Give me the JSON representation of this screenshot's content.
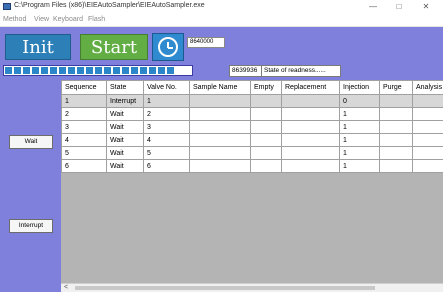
{
  "window": {
    "title": "C:\\Program Files (x86)\\EIEAutoSampler\\EIEAutoSampler.exe",
    "minimize": "—",
    "maximize": "□",
    "close": "✕"
  },
  "menu": [
    "Method",
    "View",
    "Keyboard",
    "Flash"
  ],
  "toolbar": {
    "init_label": "Init",
    "start_label": "Start",
    "counter_top": "8640000"
  },
  "status": {
    "progress_fraction": 0.9,
    "counter": "8639936",
    "message": "State of readness......"
  },
  "side": {
    "wait_label": "Wait",
    "interrupt_label": "Interrupt"
  },
  "table": {
    "headers": [
      "Sequence",
      "State",
      "Valve No.",
      "Sample Name",
      "Empty",
      "Replacement",
      "Injection",
      "Purge",
      "Analysis"
    ],
    "rows": [
      [
        "1",
        "Interrupt",
        "1",
        "",
        "",
        "",
        "0",
        "",
        ""
      ],
      [
        "2",
        "Wait",
        "2",
        "",
        "",
        "",
        "1",
        "",
        ""
      ],
      [
        "3",
        "Wait",
        "3",
        "",
        "",
        "",
        "1",
        "",
        ""
      ],
      [
        "4",
        "Wait",
        "4",
        "",
        "",
        "",
        "1",
        "",
        ""
      ],
      [
        "5",
        "Wait",
        "5",
        "",
        "",
        "",
        "1",
        "",
        ""
      ],
      [
        "6",
        "Wait",
        "6",
        "",
        "",
        "",
        "1",
        "",
        ""
      ]
    ],
    "selected_row": 0
  },
  "scrollbar": {
    "left_arrow": "<"
  },
  "colors": {
    "background": "#7f7fdc",
    "init": "#2d7fb8",
    "start": "#62ad44",
    "clock": "#2f8ad0"
  }
}
